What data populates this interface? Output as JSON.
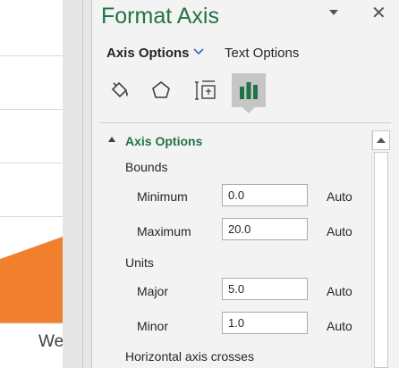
{
  "chart": {
    "axis_label_partial": "We",
    "series_color": "#f07f2e"
  },
  "pane": {
    "title": "Format Axis",
    "tabs": [
      {
        "label": "Axis Options",
        "active": true
      },
      {
        "label": "Text Options",
        "active": false
      }
    ],
    "icons": [
      {
        "name": "fill-line-icon",
        "selected": false
      },
      {
        "name": "effects-icon",
        "selected": false
      },
      {
        "name": "size-properties-icon",
        "selected": false
      },
      {
        "name": "axis-options-icon",
        "selected": true
      }
    ],
    "section_title": "Axis Options",
    "bounds": {
      "label": "Bounds",
      "minimum": {
        "label": "Minimum",
        "value": "0.0",
        "mode": "Auto"
      },
      "maximum": {
        "label": "Maximum",
        "value": "20.0",
        "mode": "Auto"
      }
    },
    "units": {
      "label": "Units",
      "major": {
        "label": "Major",
        "value": "5.0",
        "mode": "Auto"
      },
      "minor": {
        "label": "Minor",
        "value": "1.0",
        "mode": "Auto"
      }
    },
    "horizontal_axis_crosses": {
      "label": "Horizontal axis crosses"
    },
    "accent_color": "#217346"
  }
}
